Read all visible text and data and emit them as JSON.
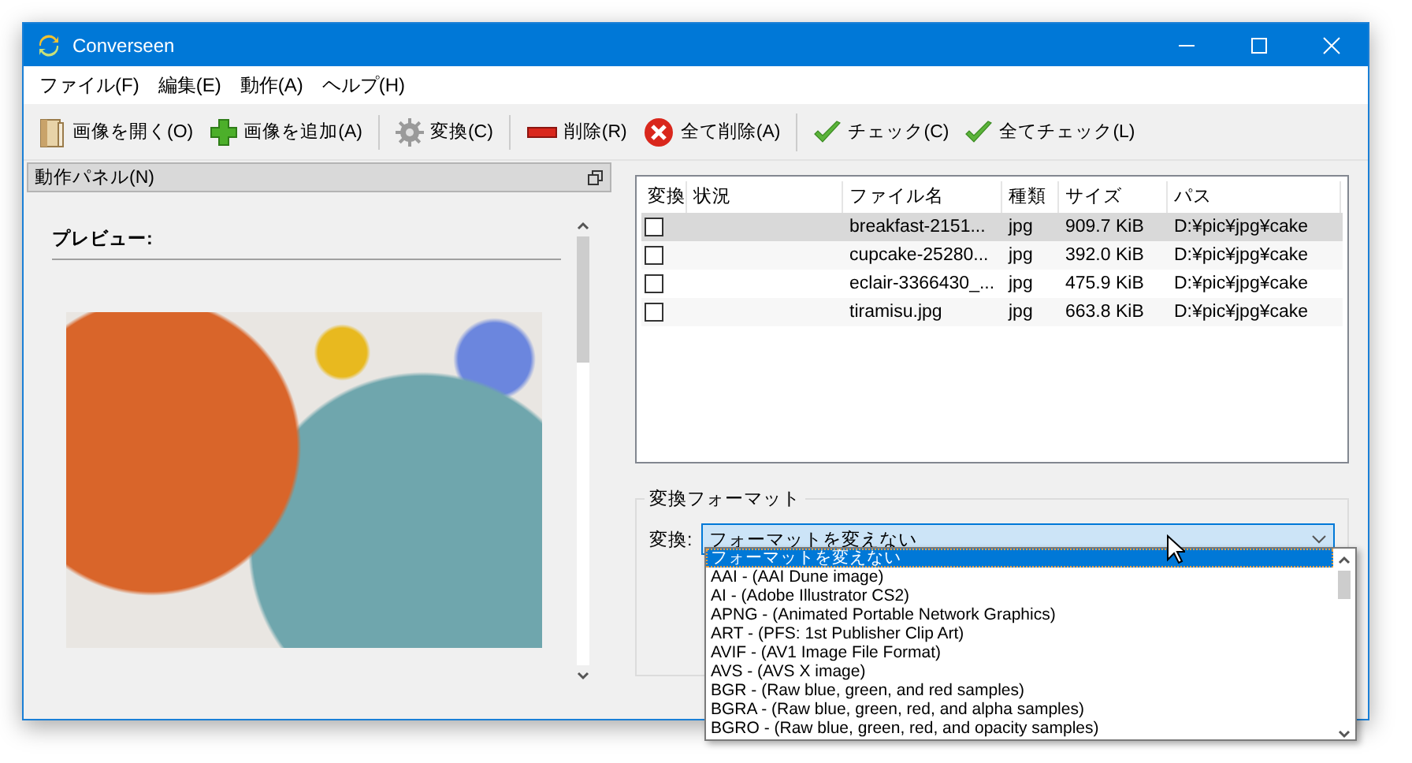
{
  "window": {
    "title": "Converseen"
  },
  "menu": [
    {
      "label": "ファイル(F)"
    },
    {
      "label": "編集(E)"
    },
    {
      "label": "動作(A)"
    },
    {
      "label": "ヘルプ(H)"
    }
  ],
  "toolbar": [
    {
      "kind": "open",
      "label": "画像を開く(O)",
      "separator_after": false
    },
    {
      "kind": "add",
      "label": "画像を追加(A)",
      "separator_after": true
    },
    {
      "kind": "convert",
      "label": "変換(C)",
      "separator_after": true
    },
    {
      "kind": "delete",
      "label": "削除(R)",
      "separator_after": false
    },
    {
      "kind": "delete_all",
      "label": "全て削除(A)",
      "separator_after": true
    },
    {
      "kind": "check",
      "label": "チェック(C)",
      "separator_after": false
    },
    {
      "kind": "check_all",
      "label": "全てチェック(L)",
      "separator_after": false
    }
  ],
  "action_panel": {
    "title": "動作パネル(N)",
    "preview_label": "プレビュー:"
  },
  "table": {
    "columns": [
      "変換",
      "状況",
      "ファイル名",
      "種類",
      "サイズ",
      "パス"
    ],
    "rows": [
      {
        "checked": false,
        "selected": true,
        "name": "breakfast-2151...",
        "type": "jpg",
        "size": "909.7 KiB",
        "path": "D:¥pic¥jpg¥cake"
      },
      {
        "checked": false,
        "selected": false,
        "name": "cupcake-25280...",
        "type": "jpg",
        "size": "392.0 KiB",
        "path": "D:¥pic¥jpg¥cake"
      },
      {
        "checked": false,
        "selected": false,
        "name": "eclair-3366430_...",
        "type": "jpg",
        "size": "475.9 KiB",
        "path": "D:¥pic¥jpg¥cake"
      },
      {
        "checked": false,
        "selected": false,
        "name": "tiramisu.jpg",
        "type": "jpg",
        "size": "663.8 KiB",
        "path": "D:¥pic¥jpg¥cake"
      }
    ]
  },
  "format": {
    "group_title": "変換フォーマット",
    "label": "変換:",
    "value": "フォーマットを変えない",
    "options": [
      {
        "label": "フォーマットを変えない",
        "selected": true
      },
      {
        "label": "AAI - (AAI Dune image)",
        "selected": false
      },
      {
        "label": "AI - (Adobe Illustrator CS2)",
        "selected": false
      },
      {
        "label": "APNG - (Animated Portable Network Graphics)",
        "selected": false
      },
      {
        "label": "ART - (PFS: 1st Publisher Clip Art)",
        "selected": false
      },
      {
        "label": "AVIF - (AV1 Image File Format)",
        "selected": false
      },
      {
        "label": "AVS - (AVS X image)",
        "selected": false
      },
      {
        "label": "BGR - (Raw blue, green, and red samples)",
        "selected": false
      },
      {
        "label": "BGRA - (Raw blue, green, red, and alpha samples)",
        "selected": false
      },
      {
        "label": "BGRO - (Raw blue, green, red, and opacity samples)",
        "selected": false
      }
    ]
  }
}
